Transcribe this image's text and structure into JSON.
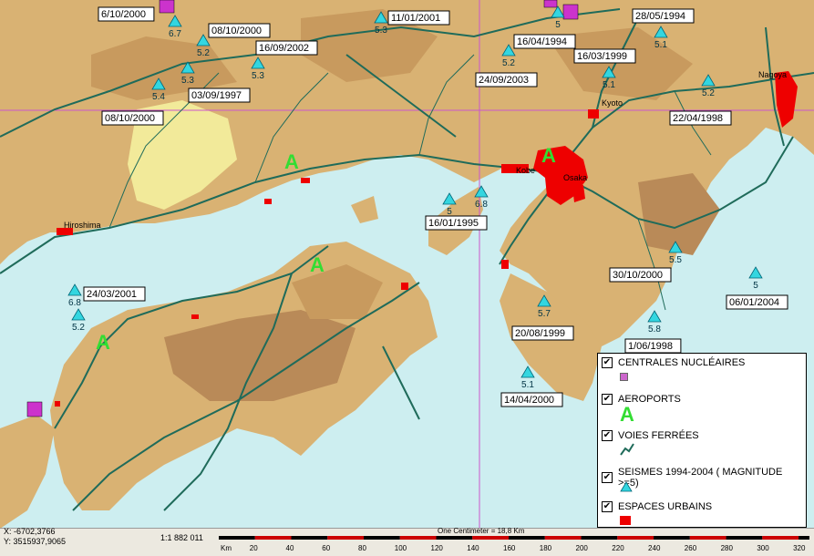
{
  "map": {
    "place_labels": {
      "hiroshima": "Hiroshima",
      "kobe": "Kobe",
      "osaka": "Osaka",
      "kyoto": "Kyoto",
      "nagoya": "Nagoya"
    },
    "quakes": [
      {
        "mag": "6.7"
      },
      {
        "mag": "5.2"
      },
      {
        "mag": "5.3"
      },
      {
        "mag": "5.4"
      },
      {
        "mag": "5.3"
      },
      {
        "mag": "5.3"
      },
      {
        "mag": "5.2"
      },
      {
        "mag": "5.1"
      },
      {
        "mag": "5.1"
      },
      {
        "mag": "5.2"
      },
      {
        "mag": "5"
      },
      {
        "mag": "6.8"
      },
      {
        "mag": "6.8"
      },
      {
        "mag": "5.2"
      },
      {
        "mag": "5.5"
      },
      {
        "mag": "5"
      },
      {
        "mag": "5.7"
      },
      {
        "mag": "5.8"
      },
      {
        "mag": "5.1"
      },
      {
        "mag": "5"
      }
    ],
    "date_labels": {
      "d1": "6/10/2000",
      "d2": "08/10/2000",
      "d3": "16/09/2002",
      "d4": "03/09/1997",
      "d5": "08/10/2000",
      "d6": "11/01/2001",
      "d7": "16/04/1994",
      "d8": "16/03/1999",
      "d9": "24/09/2003",
      "d10": "28/05/1994",
      "d11": "22/04/1998",
      "d12": "16/01/1995",
      "d13": "24/03/2001",
      "d14": "30/10/2000",
      "d15": "06/01/2004",
      "d16": "20/08/1999",
      "d17": "1/06/1998",
      "d18": "14/04/2000"
    }
  },
  "legend": {
    "items": [
      {
        "label": "CENTRALES NUCLÉAIRES",
        "checked": "✔",
        "color": "#cc66cc"
      },
      {
        "label": "AEROPORTS",
        "checked": "✔",
        "symbol": "A",
        "color": "#33dd33"
      },
      {
        "label": "VOIES FERRÉES",
        "checked": "✔",
        "color": "#1f6b5a"
      },
      {
        "label": "SEISMES 1994-2004 ( MAGNITUDE >=5)",
        "checked": "✔",
        "color": "#33d6e0"
      },
      {
        "label": "ESPACES URBAINS",
        "checked": "✔",
        "color": "#ee0000"
      }
    ]
  },
  "status": {
    "x_coord": "X: -6702,3766",
    "y_coord": "Y: 3515937,9065",
    "scale": "1:1 882 011",
    "scale_caption": "One Centimeter = 18,8 Km",
    "scale_unit": "Km",
    "scale_ticks": [
      "20",
      "40",
      "60",
      "80",
      "100",
      "120",
      "140",
      "160",
      "180",
      "200",
      "220",
      "240",
      "260",
      "280",
      "300",
      "320"
    ]
  }
}
